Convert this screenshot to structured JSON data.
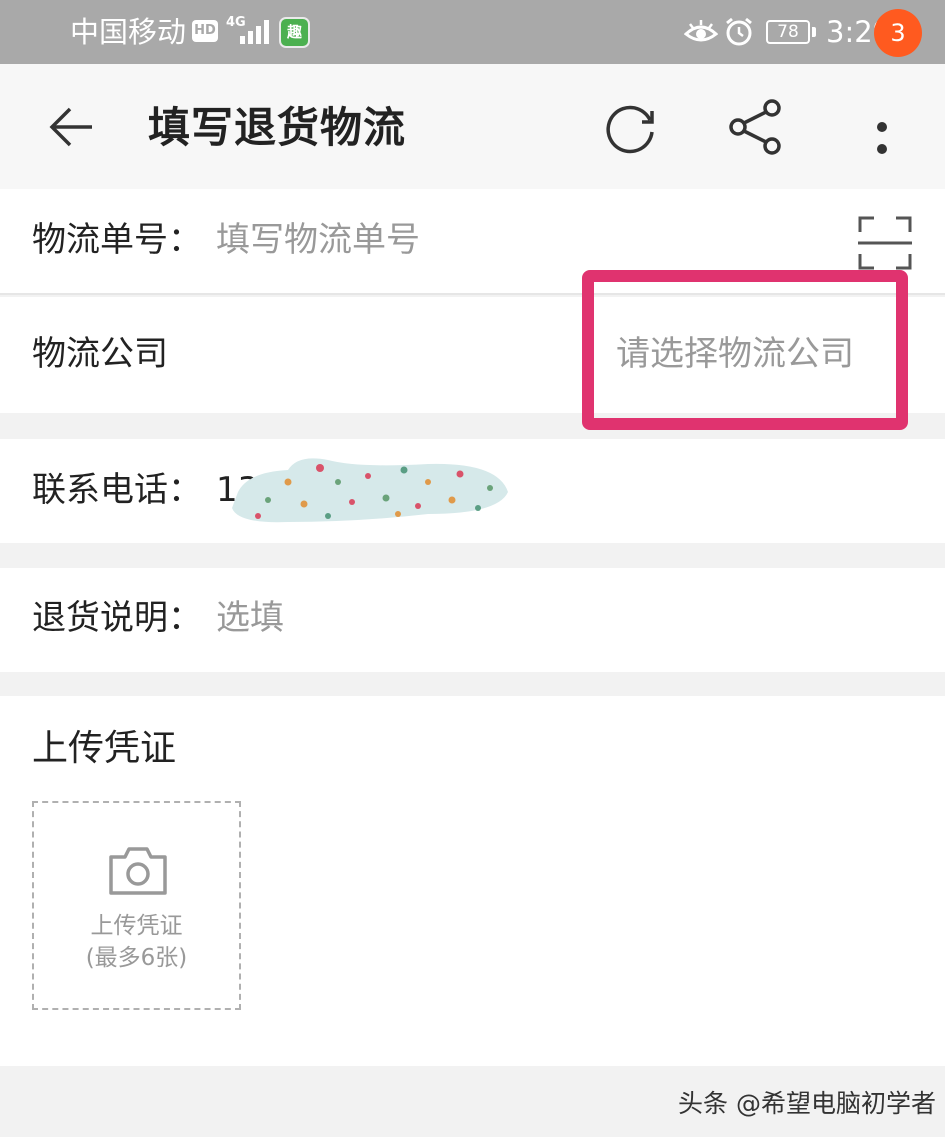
{
  "status_bar": {
    "carrier": "中国移动",
    "hd": "HD",
    "network": "4G",
    "app_icon_glyph": "趣",
    "battery": "78",
    "time": "3:29"
  },
  "header": {
    "title": "填写退货物流",
    "badge_count": "3",
    "icons": [
      "back-arrow-icon",
      "refresh-icon",
      "share-icon",
      "more-icon"
    ]
  },
  "form": {
    "tracking": {
      "label": "物流单号：",
      "placeholder": "填写物流单号"
    },
    "company": {
      "label": "物流公司",
      "placeholder": "请选择物流公司"
    },
    "phone": {
      "label": "联系电话：",
      "value": "135"
    },
    "note": {
      "label": "退货说明：",
      "placeholder": "选填"
    }
  },
  "upload": {
    "title": "上传凭证",
    "button_line1": "上传凭证",
    "button_line2": "(最多6张)"
  },
  "watermark": "头条 @希望电脑初学者",
  "colors": {
    "status_bar": "#a9a9a9",
    "badge": "#ff5a1f",
    "highlight": "#e0336f",
    "placeholder": "#999999"
  }
}
